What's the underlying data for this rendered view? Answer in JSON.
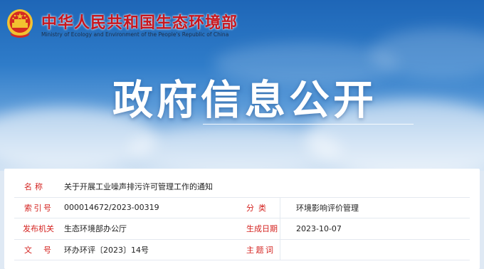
{
  "header": {
    "ministry_cn": "中华人民共和国生态环境部",
    "ministry_en": "Ministry of Ecology and Environment of the People's Republic of China",
    "emblem_icon": "national-emblem-icon"
  },
  "banner": {
    "title": "政府信息公开"
  },
  "info": {
    "name_label": "名称",
    "name_value": "关于开展工业噪声排污许可管理工作的通知",
    "index_label": "索引号",
    "index_value": "000014672/2023-00319",
    "category_label": "分类",
    "category_value": "环境影响评价管理",
    "issuer_label": "发布机关",
    "issuer_value": "生态环境部办公厅",
    "date_label": "生成日期",
    "date_value": "2023-10-07",
    "docno_label": "文号",
    "docno_value": "环办环评〔2023〕14号",
    "subject_label": "主题词",
    "subject_value": ""
  },
  "colors": {
    "brand_red": "#c8161d",
    "label_red": "#d4221f",
    "sky_blue": "#2f7cc9"
  }
}
